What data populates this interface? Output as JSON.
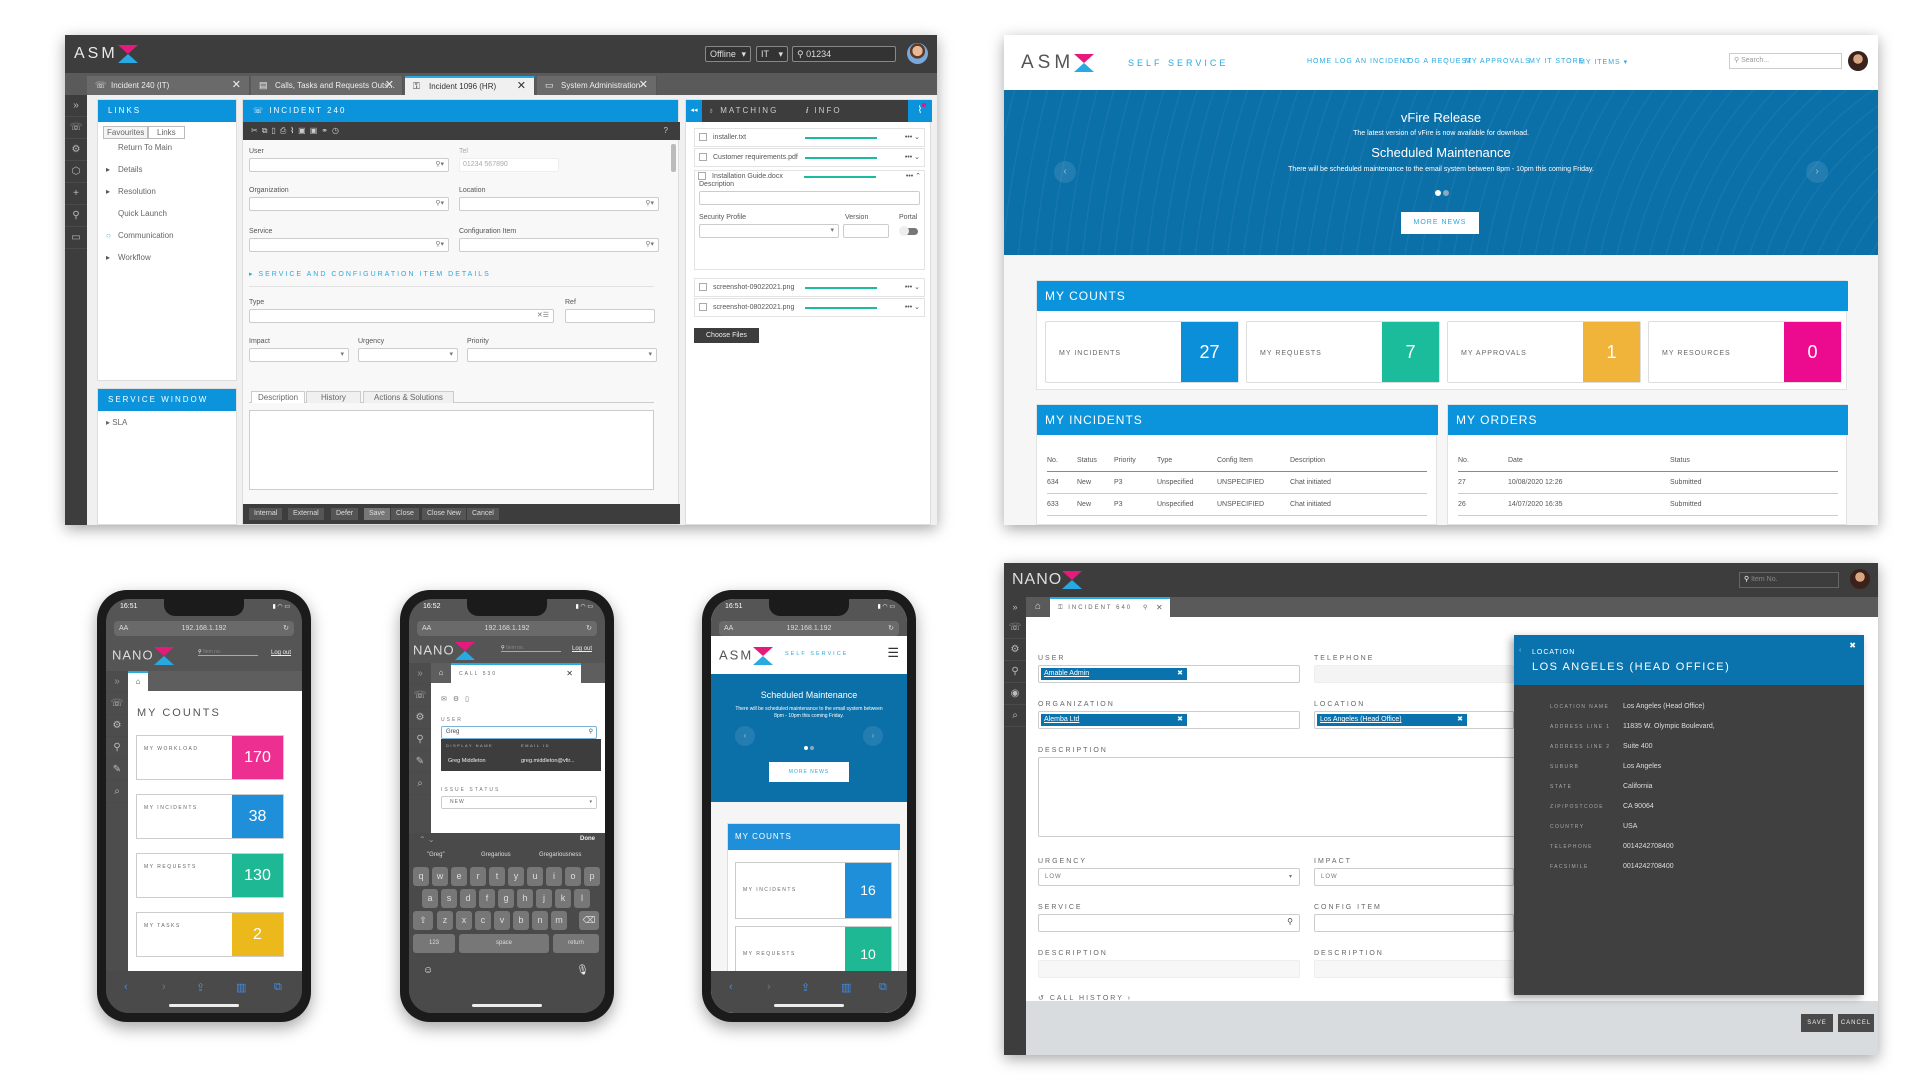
{
  "asm_desktop": {
    "logo": "ASM",
    "header": {
      "mode_select": "Offline",
      "dept_select": "IT",
      "search_value": "01234"
    },
    "tabs": [
      {
        "label": "Incident 240 (IT)",
        "icon": "phone-icon"
      },
      {
        "label": "Calls, Tasks and Requests Outs...",
        "icon": "document-icon"
      },
      {
        "label": "Incident 1096 (HR)",
        "icon": "lock-icon",
        "active": true
      },
      {
        "label": "System Administration",
        "icon": "briefcase-icon"
      }
    ],
    "rail_icons": [
      "expand-icon",
      "phone-icon",
      "gear-icon",
      "cube-icon",
      "plus-icon",
      "pin-icon",
      "briefcase-icon"
    ],
    "links_panel": {
      "title": "LINKS",
      "tabs": [
        "Favourites",
        "Links"
      ],
      "items": [
        {
          "label": "Return To Main",
          "marker": ""
        },
        {
          "label": "Details",
          "marker": "▸"
        },
        {
          "label": "Resolution",
          "marker": "▸"
        },
        {
          "label": "Quick Launch",
          "marker": ""
        },
        {
          "label": "Communication",
          "marker": "○"
        },
        {
          "label": "Workflow",
          "marker": "▸"
        }
      ]
    },
    "service_window": {
      "title": "SERVICE WINDOW",
      "items": [
        "SLA"
      ]
    },
    "incident": {
      "title": "INCIDENT 240",
      "fields": {
        "user": "User",
        "tel": "Tel",
        "tel_placeholder": "01234 567890",
        "organization": "Organization",
        "location": "Location",
        "service": "Service",
        "config_item": "Configuration Item",
        "type": "Type",
        "ref": "Ref",
        "impact": "Impact",
        "urgency": "Urgency",
        "priority": "Priority"
      },
      "section_toggle": "SERVICE AND CONFIGURATION ITEM DETAILS",
      "detail_tabs": [
        "Description",
        "History",
        "Actions & Solutions"
      ],
      "buttons": [
        "Internal",
        "External",
        "Defer",
        "Save",
        "Close",
        "Close New",
        "Cancel"
      ]
    },
    "matching_panel": {
      "tab_matching": "MATCHING",
      "tab_info": "INFO",
      "files": [
        "installer.txt",
        "Customer requirements.pdf",
        "Installation Guide.docx",
        "screenshot-09022021.png",
        "screenshot-08022021.png"
      ],
      "expanded": {
        "description_label": "Description",
        "security_profile_label": "Security Profile",
        "version_label": "Version",
        "portal_label": "Portal",
        "portal_on": false
      },
      "choose_files": "Choose Files"
    }
  },
  "self_service": {
    "logo": "ASM",
    "logo_sub": "SELF SERVICE",
    "nav": [
      "HOME",
      "LOG AN INCIDENT",
      "LOG A REQUEST",
      "MY APPROVALS",
      "MY IT STORE",
      "MY ITEMS ▾"
    ],
    "search_placeholder": "Search...",
    "banner": {
      "title1": "vFire Release",
      "text1": "The latest version of vFire is now available for download.",
      "title2": "Scheduled Maintenance",
      "text2": "There will be scheduled maintenance to the email system between 8pm - 10pm this coming Friday.",
      "button": "MORE NEWS",
      "slide_index": 1,
      "slide_count": 2
    },
    "counts": {
      "title": "MY COUNTS",
      "items": [
        {
          "label": "MY INCIDENTS",
          "value": "27",
          "color": "#0b8fd8"
        },
        {
          "label": "MY REQUESTS",
          "value": "7",
          "color": "#1abc9c"
        },
        {
          "label": "MY APPROVALS",
          "value": "1",
          "color": "#f1b43a"
        },
        {
          "label": "MY RESOURCES",
          "value": "0",
          "color": "#ec0b8f"
        }
      ]
    },
    "incidents": {
      "title": "MY INCIDENTS",
      "columns": [
        "No.",
        "Status",
        "Priority",
        "Type",
        "Config Item",
        "Description"
      ],
      "rows": [
        [
          "634",
          "New",
          "P3",
          "Unspecified",
          "UNSPECIFIED",
          "Chat initiated"
        ],
        [
          "633",
          "New",
          "P3",
          "Unspecified",
          "UNSPECIFIED",
          "Chat initiated"
        ]
      ]
    },
    "orders": {
      "title": "MY ORDERS",
      "columns": [
        "No.",
        "Date",
        "Status"
      ],
      "rows": [
        [
          "27",
          "10/08/2020 12:26",
          "Submitted"
        ],
        [
          "26",
          "14/07/2020 16:35",
          "Submitted"
        ]
      ]
    }
  },
  "phone1": {
    "time": "16:51",
    "url": "192.168.1.192",
    "text_size": "AA",
    "logo": "NANO",
    "search_placeholder": "Item no.",
    "logout": "Log out",
    "title": "MY COUNTS",
    "counts": [
      {
        "label": "MY WORKLOAD",
        "value": "170",
        "color": "#ec2f90"
      },
      {
        "label": "MY INCIDENTS",
        "value": "38",
        "color": "#1e8fd8"
      },
      {
        "label": "MY REQUESTS",
        "value": "130",
        "color": "#1fb895"
      },
      {
        "label": "MY TASKS",
        "value": "2",
        "color": "#ebb91c"
      }
    ]
  },
  "phone2": {
    "time": "16:52",
    "url": "192.168.1.192",
    "text_size": "AA",
    "logo": "NANO",
    "search_placeholder": "Item no.",
    "logout": "Log out",
    "tab_title": "CALL 530",
    "user_label": "USER",
    "user_value": "Greg",
    "lookup_columns": [
      "DISPLAY NAME",
      "EMAIL ID"
    ],
    "lookup_row": [
      "Greg Middleton",
      "greg.middleton@vfir..."
    ],
    "issue_status_label": "ISSUE STATUS",
    "issue_status_value": "NEW",
    "done": "Done",
    "suggestions": [
      "\"Greg\"",
      "Gregarious",
      "Gregariousness"
    ],
    "keys_row1": [
      "q",
      "w",
      "e",
      "r",
      "t",
      "y",
      "u",
      "i",
      "o",
      "p"
    ],
    "keys_row2": [
      "a",
      "s",
      "d",
      "f",
      "g",
      "h",
      "j",
      "k",
      "l"
    ],
    "keys_row3": [
      "z",
      "x",
      "c",
      "v",
      "b",
      "n",
      "m"
    ],
    "key_123": "123",
    "key_space": "space",
    "key_return": "return"
  },
  "phone3": {
    "time": "16:51",
    "url": "192.168.1.192",
    "text_size": "AA",
    "logo": "ASM",
    "logo_sub": "SELF SERVICE",
    "banner_title": "Scheduled Maintenance",
    "banner_text": "There will be scheduled maintenance to the email system between 8pm - 10pm this coming Friday.",
    "button": "MORE NEWS",
    "counts_title": "MY COUNTS",
    "counts": [
      {
        "label": "MY INCIDENTS",
        "value": "16",
        "color": "#1e8fd8"
      },
      {
        "label": "MY REQUESTS",
        "value": "10",
        "color": "#1fb895"
      }
    ]
  },
  "nano_desktop": {
    "logo": "NANO",
    "search_placeholder": "Item No.",
    "tab_title": "INCIDENT 640",
    "fields": {
      "user_label": "USER",
      "user_value": "Amable Admin",
      "telephone_label": "TELEPHONE",
      "organization_label": "ORGANIZATION",
      "organization_value": "Alemba Ltd",
      "location_label": "LOCATION",
      "location_value": "Los Angeles (Head Office)",
      "description_label": "DESCRIPTION",
      "urgency_label": "URGENCY",
      "urgency_value": "LOW",
      "impact_label": "IMPACT",
      "impact_value": "LOW",
      "service_label": "SERVICE",
      "config_item_label": "CONFIG ITEM",
      "description2_label": "DESCRIPTION",
      "description3_label": "DESCRIPTION"
    },
    "call_history": "CALL HISTORY ›",
    "save": "SAVE",
    "cancel": "CANCEL",
    "location_panel": {
      "caption": "LOCATION",
      "title": "LOS ANGELES (HEAD OFFICE)",
      "rows": [
        {
          "key": "LOCATION NAME",
          "value": "Los Angeles (Head Office)"
        },
        {
          "key": "ADDRESS LINE 1",
          "value": "11835 W. Olympic Boulevard,"
        },
        {
          "key": "ADDRESS LINE 2",
          "value": "Suite 400"
        },
        {
          "key": "SUBURB",
          "value": "Los Angeles"
        },
        {
          "key": "STATE",
          "value": "California"
        },
        {
          "key": "ZIP/POSTCODE",
          "value": "CA 90064"
        },
        {
          "key": "COUNTRY",
          "value": "USA"
        },
        {
          "key": "TELEPHONE",
          "value": "0014242708400"
        },
        {
          "key": "FACSIMILE",
          "value": "0014242708400"
        }
      ]
    }
  }
}
